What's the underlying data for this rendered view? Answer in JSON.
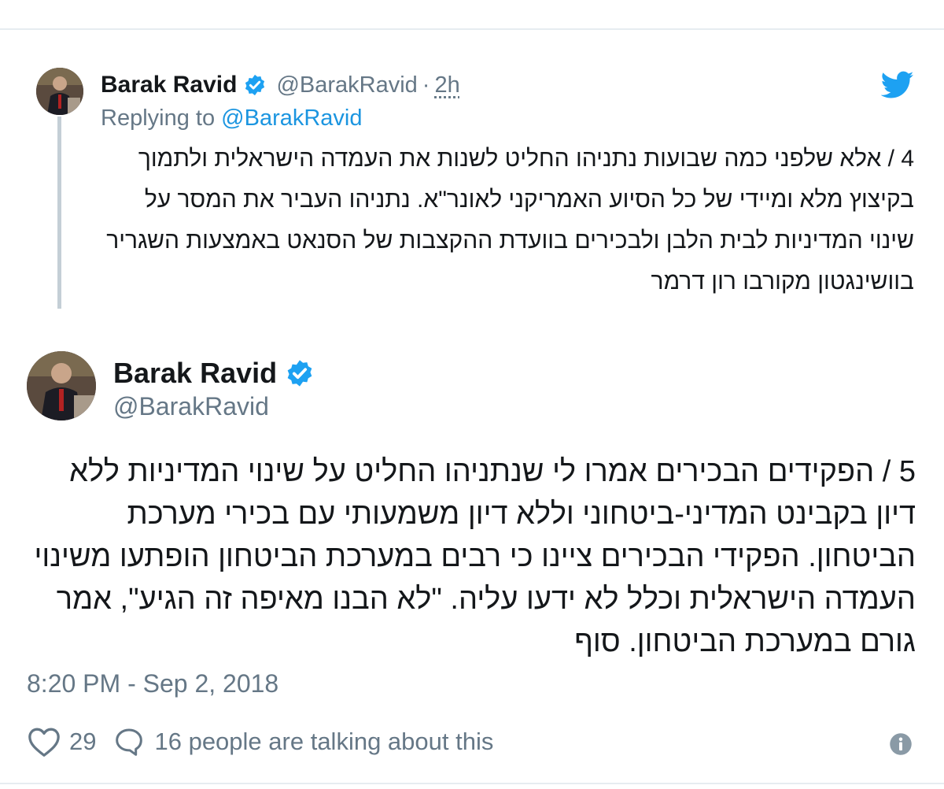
{
  "reply_tweet": {
    "author_name": "Barak Ravid",
    "handle": "@BarakRavid",
    "separator": "·",
    "time_ago": "2h",
    "replying_prefix": "Replying to",
    "replying_handle": "@BarakRavid",
    "body": "4 / אלא שלפני כמה שבועות נתניהו החליט לשנות את העמדה הישראלית ולתמוך בקיצוץ מלא ומיידי של כל הסיוע האמריקני לאונר\"א. נתניהו העביר את המסר על שינוי המדיניות לבית הלבן ולבכירים בוועדת ההקצבות של הסנאט באמצעות השגריר בוושינגטון מקורבו רון דרמר"
  },
  "main_tweet": {
    "author_name": "Barak Ravid",
    "handle": "@BarakRavid",
    "body": "5 / הפקידים הבכירים אמרו לי שנתניהו החליט על שינוי המדיניות ללא דיון בקבינט המדיני-ביטחוני וללא דיון משמעותי עם בכירי מערכת הביטחון. הפקידי הבכירים ציינו כי רבים במערכת הביטחון הופתעו משינוי העמדה הישראלית וכלל לא ידעו עליה. \"לא הבנו מאיפה זה הגיע\", אמר גורם במערכת הביטחון. סוף",
    "timestamp": "8:20 PM - Sep 2, 2018",
    "like_count": "29",
    "talking_text": "16 people are talking about this"
  },
  "colors": {
    "verified": "#1da1f2",
    "twitter_brand": "#1da1f2",
    "secondary_text": "#657786",
    "link": "#1b95e0",
    "thread_line": "#c4cfd6"
  },
  "icons": {
    "verified": "verified-badge-icon",
    "brand": "twitter-bird-icon",
    "like": "heart-icon",
    "reply": "speech-bubble-icon",
    "info": "info-icon"
  }
}
